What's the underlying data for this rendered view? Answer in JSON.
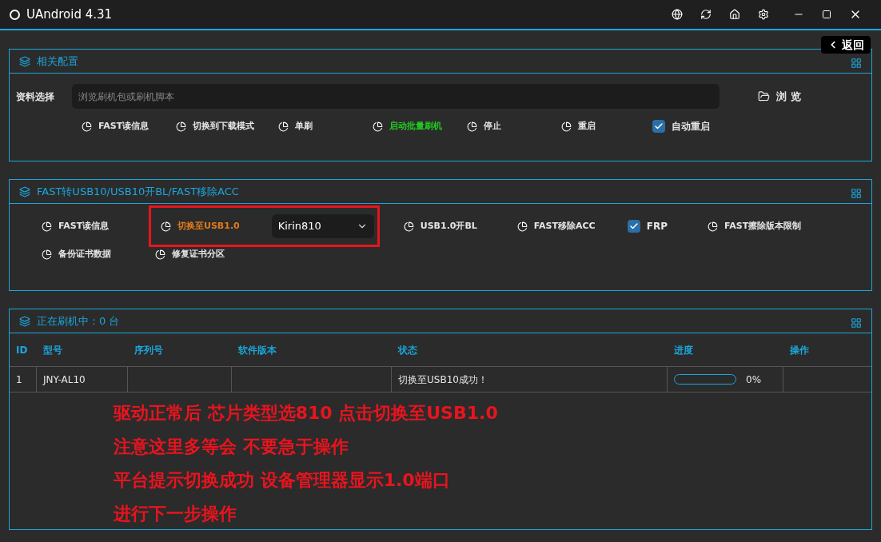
{
  "window": {
    "title": "UAndroid 4.31"
  },
  "back_button": {
    "label": "返回"
  },
  "config_panel": {
    "title": "相关配置",
    "file_label": "资料选择",
    "file_placeholder": "浏览刷机包或刷机脚本",
    "browse_button": "浏 览",
    "actions": [
      {
        "kind": "button",
        "label": "FAST读信息"
      },
      {
        "kind": "button",
        "label": "切换到下载模式"
      },
      {
        "kind": "button",
        "label": "单刷"
      },
      {
        "kind": "button",
        "label": "启动批量刷机",
        "color": "#22cc22"
      },
      {
        "kind": "button",
        "label": "停止"
      },
      {
        "kind": "button",
        "label": "重启"
      },
      {
        "kind": "checkbox",
        "label": "自动重启",
        "checked": true
      }
    ]
  },
  "usb_panel": {
    "title": "FAST转USB10/USB10开BL/FAST移除ACC",
    "rows": [
      [
        {
          "kind": "button",
          "label": "FAST读信息"
        },
        {
          "kind": "group",
          "outlined": true,
          "items": [
            {
              "kind": "button",
              "label": "切换至USB1.0",
              "color": "#e07b1a"
            },
            {
              "kind": "select",
              "value": "Kirin810"
            }
          ]
        },
        {
          "kind": "button",
          "label": "USB1.0开BL"
        },
        {
          "kind": "button",
          "label": "FAST移除ACC"
        },
        {
          "kind": "checkbox",
          "label": "FRP",
          "checked": true
        },
        {
          "kind": "button",
          "label": "FAST擦除版本限制"
        }
      ],
      [
        {
          "kind": "button",
          "label": "备份证书数据"
        },
        {
          "kind": "button",
          "label": "修复证书分区"
        }
      ]
    ]
  },
  "flash_panel": {
    "title": "正在刷机中：0 台",
    "table": {
      "columns": [
        "ID",
        "型号",
        "序列号",
        "软件版本",
        "状态",
        "进度",
        "操作"
      ],
      "rows": [
        {
          "id": "1",
          "model": "JNY-AL10",
          "serial": "",
          "version": "",
          "status": "切换至USB10成功！",
          "progress": {
            "level": 0,
            "reading": "0%"
          },
          "action": ""
        }
      ]
    }
  },
  "notes": [
    "驱动正常后 芯片类型选810 点击切换至USB1.0",
    "注意这里多等会 不要急于操作",
    "平台提示切换成功 设备管理器显示1.0端口",
    "进行下一步操作"
  ]
}
